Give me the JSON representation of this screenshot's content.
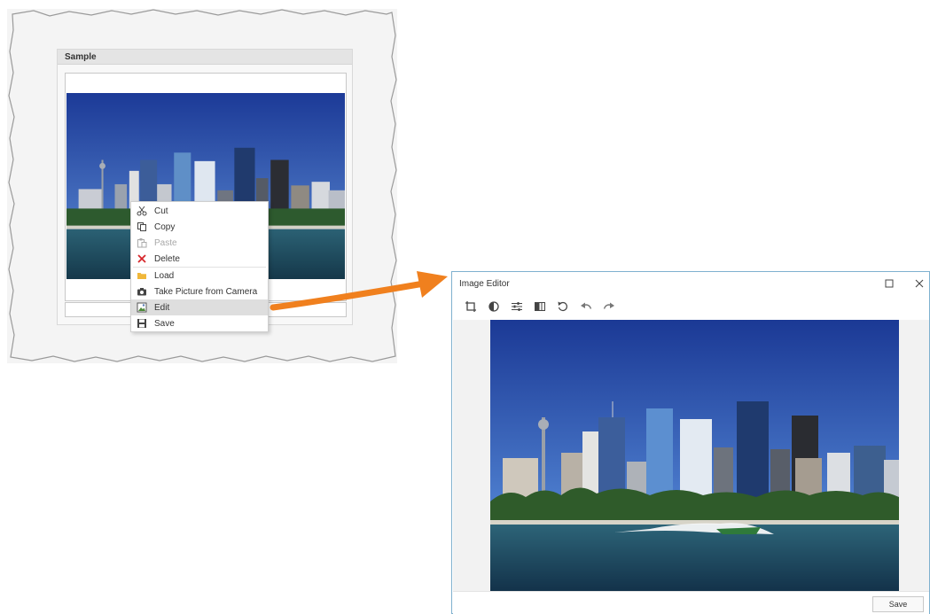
{
  "sample": {
    "title": "Sample",
    "image_name": "sydney-skyline-photo"
  },
  "context_menu": {
    "items": [
      {
        "label": "Cut",
        "icon": "scissors-icon",
        "state": "enabled"
      },
      {
        "label": "Copy",
        "icon": "copy-icon",
        "state": "enabled"
      },
      {
        "label": "Paste",
        "icon": "paste-icon",
        "state": "disabled"
      },
      {
        "label": "Delete",
        "icon": "delete-x-icon",
        "state": "enabled"
      },
      {
        "label": "Load",
        "icon": "folder-icon",
        "state": "enabled"
      },
      {
        "label": "Take Picture from Camera",
        "icon": "camera-icon",
        "state": "enabled"
      },
      {
        "label": "Edit",
        "icon": "edit-image-icon",
        "state": "highlighted"
      },
      {
        "label": "Save",
        "icon": "floppy-disk-icon",
        "state": "enabled"
      }
    ]
  },
  "dialog": {
    "title": "Image Editor",
    "toolbar": [
      "crop-icon",
      "contrast-icon",
      "adjust-sliders-icon",
      "flip-icon",
      "rotate-icon",
      "undo-icon",
      "redo-icon"
    ],
    "save_label": "Save"
  },
  "colors": {
    "arrow": "#f0801e",
    "dialog_border": "#7fb1cf",
    "delete_icon": "#d6262b",
    "folder_icon": "#f0b73a",
    "menu_highlight": "#dedede",
    "sky": "#1d3f9e",
    "water": "#1d4a5c"
  }
}
